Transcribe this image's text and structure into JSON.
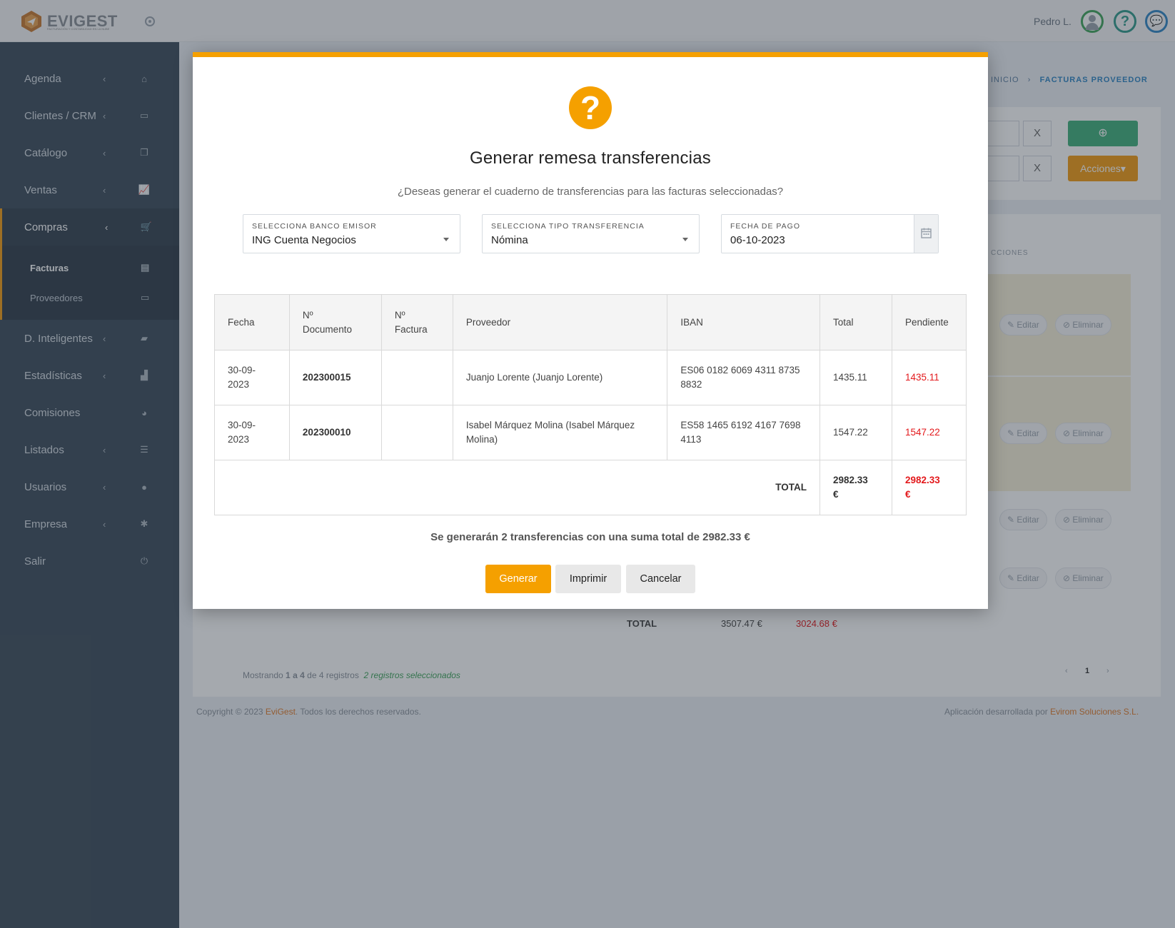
{
  "app": {
    "logo_main": "EVI",
    "logo_accent": "GEST",
    "logo_tagline": "FACTURACIÓN Y CONTABILIDAD EN LA NUBE",
    "user_name": "Pedro L.",
    "help_glyph": "?",
    "chat_glyph": "💬"
  },
  "sidebar": {
    "items": [
      {
        "label": "Agenda",
        "icon": "home-icon",
        "glyph": "⌂",
        "chevron": "‹"
      },
      {
        "label": "Clientes / CRM",
        "icon": "id-card-icon",
        "glyph": "▭",
        "chevron": "‹"
      },
      {
        "label": "Catálogo",
        "icon": "copy-icon",
        "glyph": "❐",
        "chevron": "‹"
      },
      {
        "label": "Ventas",
        "icon": "line-chart-icon",
        "glyph": "📈",
        "chevron": "‹"
      },
      {
        "label": "Compras",
        "icon": "cart-icon",
        "glyph": "🛒",
        "chevron": "‹"
      }
    ],
    "sub_items": [
      {
        "label": "Facturas",
        "icon": "file-icon",
        "glyph": "▤"
      },
      {
        "label": "Proveedores",
        "icon": "id-card-icon",
        "glyph": "▭"
      }
    ],
    "items_after": [
      {
        "label": "D. Inteligentes",
        "icon": "folder-open-icon",
        "glyph": "▰",
        "chevron": "‹"
      },
      {
        "label": "Estadísticas",
        "icon": "area-chart-icon",
        "glyph": "▟",
        "chevron": "‹"
      },
      {
        "label": "Comisiones",
        "icon": "pie-chart-icon",
        "glyph": "◕",
        "chevron": ""
      },
      {
        "label": "Listados",
        "icon": "list-icon",
        "glyph": "☰",
        "chevron": "‹"
      },
      {
        "label": "Usuarios",
        "icon": "user-icon",
        "glyph": "●",
        "chevron": "‹"
      },
      {
        "label": "Empresa",
        "icon": "cog-icon",
        "glyph": "✱",
        "chevron": "‹"
      },
      {
        "label": "Salir",
        "icon": "power-icon",
        "glyph": "⏻",
        "chevron": ""
      }
    ]
  },
  "breadcrumb": {
    "home": "INICIO",
    "separator": "›",
    "current": "FACTURAS PROVEEDOR"
  },
  "background": {
    "acciones_label": "Acciones▾",
    "add_glyph": "⊕",
    "clear_glyph": "X",
    "column_hint": "CCIONES",
    "editar_label": "Editar",
    "eliminar_label": "Eliminar",
    "total_label": "TOTAL",
    "total_amount": "3507.47 €",
    "total_pending": "3024.68 €",
    "showing_prefix": "Mostrando",
    "showing_from": "1",
    "showing_a": "a",
    "showing_to": "4",
    "showing_de": "de 4 registros",
    "selected_text": "2 registros seleccionados",
    "page_prev": "‹",
    "page_current": "1",
    "page_next": "›",
    "copyright_prefix": "Copyright © 2023",
    "copyright_brand": "EviGest",
    "copyright_suffix": ". Todos los derechos reservados.",
    "dev_prefix": "Aplicación desarrollada por",
    "dev_company": "Evirom Soluciones S.L."
  },
  "modal": {
    "title": "Generar remesa transferencias",
    "subtitle": "¿Deseas generar el cuaderno de transferencias para las facturas seleccionadas?",
    "icon_glyph": "?",
    "fields": {
      "bank": {
        "label": "SELECCIONA BANCO EMISOR",
        "value": "ING Cuenta Negocios"
      },
      "type": {
        "label": "SELECCIONA TIPO TRANSFERENCIA",
        "value": "Nómina"
      },
      "date": {
        "label": "FECHA DE PAGO",
        "value": "06-10-2023"
      }
    },
    "table": {
      "headers": {
        "fecha": "Fecha",
        "documento_1": "Nº",
        "documento_2": "Documento",
        "factura_1": "Nº",
        "factura_2": "Factura",
        "proveedor": "Proveedor",
        "iban": "IBAN",
        "total": "Total",
        "pendiente": "Pendiente"
      },
      "rows": [
        {
          "fecha_1": "30-09-",
          "fecha_2": "2023",
          "documento": "202300015",
          "factura": "",
          "proveedor": "Juanjo Lorente (Juanjo Lorente)",
          "iban_1": "ES06 0182 6069 4311 8735",
          "iban_2": "8832",
          "total": "1435.11",
          "pendiente": "1435.11"
        },
        {
          "fecha_1": "30-09-",
          "fecha_2": "2023",
          "documento": "202300010",
          "factura": "",
          "proveedor_1": "Isabel Márquez Molina (Isabel Márquez",
          "proveedor_2": "Molina)",
          "iban_1": "ES58 1465 6192 4167 7698",
          "iban_2": "4113",
          "total": "1547.22",
          "pendiente": "1547.22"
        }
      ],
      "footer": {
        "label": "TOTAL",
        "total_1": "2982.33",
        "total_2": "€",
        "pendiente_1": "2982.33",
        "pendiente_2": "€"
      }
    },
    "summary": "Se generarán 2 transferencias con una suma total de 2982.33 €",
    "buttons": {
      "generar": "Generar",
      "imprimir": "Imprimir",
      "cancelar": "Cancelar"
    }
  },
  "colors": {
    "accent": "#f5a000",
    "sidebar": "#3c4b5a",
    "danger": "#e3191c",
    "success": "#3fb07a"
  }
}
